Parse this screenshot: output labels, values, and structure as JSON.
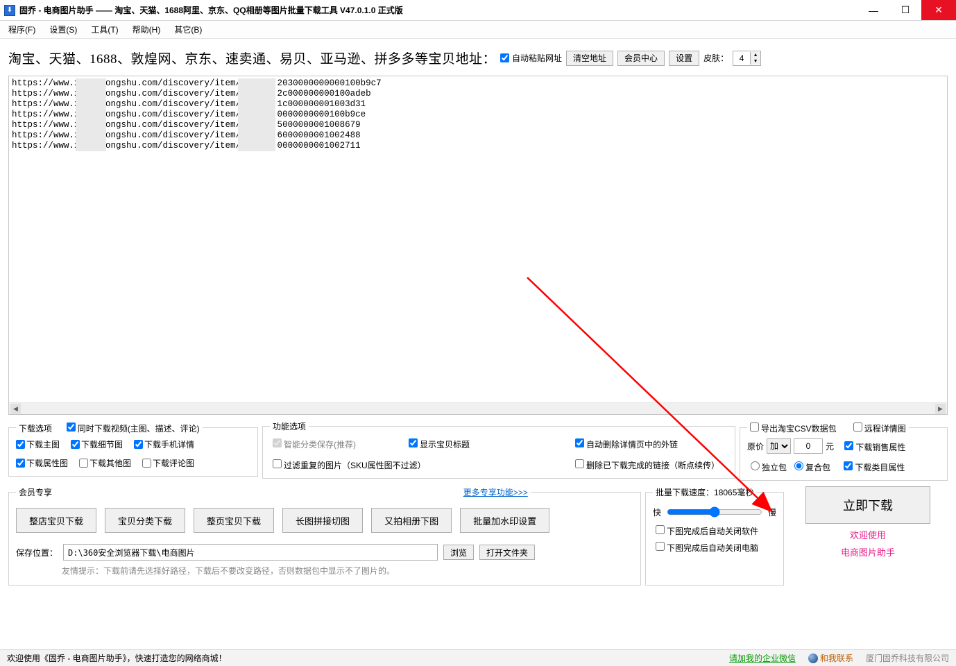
{
  "window": {
    "title": "固乔 - 电商图片助手 —— 淘宝、天猫、1688阿里、京东、QQ相册等图片批量下载工具 V47.0.1.0 正式版"
  },
  "menu": {
    "program": "程序(F)",
    "settings": "设置(S)",
    "tools": "工具(T)",
    "help": "帮助(H)",
    "other": "其它(B)"
  },
  "toolbar": {
    "address_label": "淘宝、天猫、1688、敦煌网、京东、速卖通、易贝、亚马逊、拼多多等宝贝地址：",
    "auto_paste": "自动粘贴网址",
    "clear": "清空地址",
    "member_center": "会员中心",
    "settings_btn": "设置",
    "skin_label": "皮肤：",
    "skin_value": "4"
  },
  "urls_text": "https://www.x     ongshu.com/discovery/item/       2030000000000100b9c7\nhttps://www.x     ongshu.com/discovery/item/5      2c000000000100adeb\nhttps://www.x     ongshu.com/discovery/item/5      1c000000001003d31\nhttps://www.x     ongshu.com/discovery/item/5      0000000000100b9ce\nhttps://www.x     ongshu.com/discovery/item/5f     5000000001008679\nhttps://www.x     ongshu.com/discovery/item/5f     6000000001002488\nhttps://www.x     ongshu.com/discovery/item/5f     0000000001002711",
  "download_opts": {
    "legend": "下载选项",
    "video": "同时下载视频(主图、描述、评论)",
    "main_img": "下载主图",
    "detail_img": "下载细节图",
    "mobile_detail": "下载手机详情",
    "attr_img": "下载属性图",
    "other_img": "下载其他图",
    "comment_img": "下载评论图"
  },
  "func_opts": {
    "legend": "功能选项",
    "smart_save": "智能分类保存(推荐)",
    "show_title": "显示宝贝标题",
    "auto_remove_link": "自动删除详情页中的外链",
    "filter_dup": "过滤重复的图片（SKU属性图不过滤）",
    "remove_done": "删除已下载完成的链接（断点续传）"
  },
  "export_opts": {
    "csv": "导出淘宝CSV数据包",
    "remote_detail": "远程详情图",
    "price_label_pre": "原价",
    "price_op": "加",
    "price_value": "0",
    "price_unit": "元",
    "sale_attr": "下载销售属性",
    "pack_single": "独立包",
    "pack_multi": "复合包",
    "cat_attr": "下载类目属性"
  },
  "vip": {
    "legend": "会员专享",
    "whole_shop": "整店宝贝下载",
    "classify": "宝贝分类下载",
    "whole_page": "整页宝贝下载",
    "long_slice": "长图拼接切图",
    "youpai": "又拍相册下图",
    "batch_wm": "批量加水印设置",
    "more": "更多专享功能>>>"
  },
  "speed": {
    "legend_prefix": "批量下载速度：",
    "value": "18065",
    "unit": "毫秒",
    "fast": "快",
    "slow": "慢",
    "close_soft": "下图完成后自动关闭软件",
    "close_pc": "下图完成后自动关闭电脑"
  },
  "download_now": "立即下载",
  "welcome1": "欢迎使用",
  "welcome2": "电商图片助手",
  "save": {
    "label": "保存位置：",
    "path": "D:\\360安全浏览器下载\\电商图片",
    "browse": "浏览",
    "open_folder": "打开文件夹",
    "hint": "友情提示：下载前请先选择好路径，下载后不要改变路径，否则数据包中显示不了图片的。"
  },
  "status": {
    "welcome": "欢迎使用《固乔 - 电商图片助手》，快速打造您的网络商城！",
    "wechat": "请加我的企业微信",
    "contact": "和我联系",
    "company": "厦门固乔科技有限公司"
  }
}
